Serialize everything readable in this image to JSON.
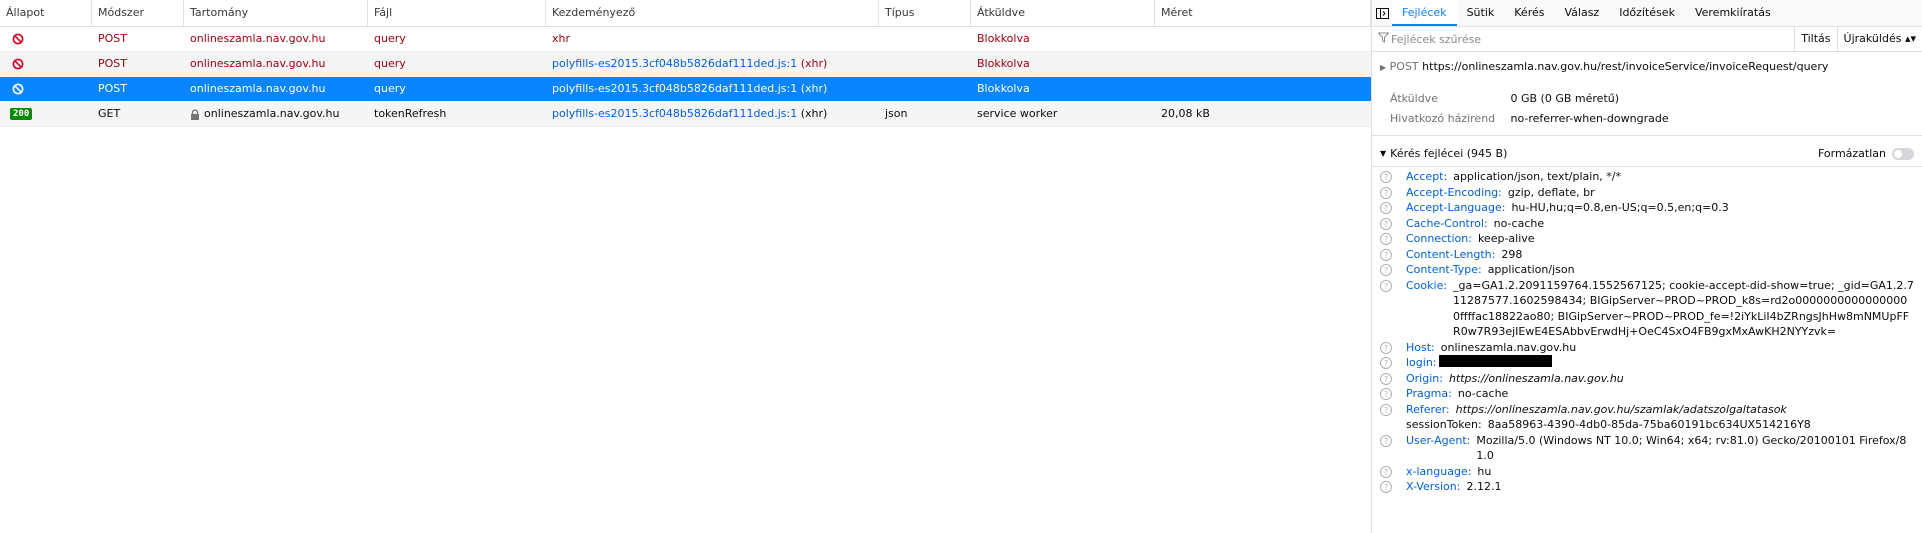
{
  "columns": [
    "Állapot",
    "Módszer",
    "Tartomány",
    "Fájl",
    "Kezdeményező",
    "Típus",
    "Átküldve",
    "Méret"
  ],
  "requests": [
    {
      "status": "blocked",
      "method": "POST",
      "domain": "onlineszamla.nav.gov.hu",
      "file": "query",
      "initiator": "xhr",
      "initiator_suffix": "",
      "type": "",
      "transferred": "Blokkolva",
      "size": ""
    },
    {
      "status": "blocked",
      "method": "POST",
      "domain": "onlineszamla.nav.gov.hu",
      "file": "query",
      "initiator": "polyfills-es2015.3cf048b5826daf111ded.js:1",
      "initiator_suffix": "(xhr)",
      "type": "",
      "transferred": "Blokkolva",
      "size": ""
    },
    {
      "status": "blocked",
      "method": "POST",
      "domain": "onlineszamla.nav.gov.hu",
      "file": "query",
      "initiator": "polyfills-es2015.3cf048b5826daf111ded.js:1",
      "initiator_suffix": "(xhr)",
      "type": "",
      "transferred": "Blokkolva",
      "size": ""
    },
    {
      "status": "200",
      "method": "GET",
      "domain": "onlineszamla.nav.gov.hu",
      "file": "tokenRefresh",
      "initiator": "polyfills-es2015.3cf048b5826daf111ded.js:1",
      "initiator_suffix": "(xhr)",
      "type": "json",
      "transferred": "service worker",
      "size": "20,08 kB"
    }
  ],
  "panel": {
    "tabs": [
      "Fejlécek",
      "Sütik",
      "Kérés",
      "Válasz",
      "Időzítések",
      "Veremkiíratás"
    ],
    "filter_placeholder": "Fejlécek szűrése",
    "block_label": "Tiltás",
    "resend_label": "Újraküldés",
    "summary": {
      "method": "POST",
      "url": "https://onlineszamla.nav.gov.hu/rest/invoiceService/invoiceRequest/query",
      "transferred_label": "Átküldve",
      "transferred_value": "0 GB (0 GB méretű)",
      "referrer_label": "Hivatkozó házirend",
      "referrer_value": "no-referrer-when-downgrade"
    },
    "request_headers_title": "Kérés fejlécei (945 B)",
    "raw_label": "Formázatlan",
    "headers": [
      {
        "name": "Accept:",
        "value": "application/json, text/plain, */*"
      },
      {
        "name": "Accept-Encoding:",
        "value": "gzip, deflate, br"
      },
      {
        "name": "Accept-Language:",
        "value": "hu-HU,hu;q=0.8,en-US;q=0.5,en;q=0.3"
      },
      {
        "name": "Cache-Control:",
        "value": "no-cache"
      },
      {
        "name": "Connection:",
        "value": "keep-alive"
      },
      {
        "name": "Content-Length:",
        "value": "298"
      },
      {
        "name": "Content-Type:",
        "value": "application/json"
      },
      {
        "name": "Cookie:",
        "value": "_ga=GA1.2.2091159764.1552567125; cookie-accept-did-show=true; _gid=GA1.2.711287577.1602598434; BIGipServer~PROD~PROD_k8s=rd2o00000000000000000ffffac18822ao80; BIGipServer~PROD~PROD_fe=!2iYkLiI4bZRngsJhHw8mNMUpFFR0w7R93ejIEwE4ESAbbvErwdHj+OeC4SxO4FB9gxMxAwKH2NYYzvk="
      },
      {
        "name": "Host:",
        "value": "onlineszamla.nav.gov.hu"
      },
      {
        "name": "login:",
        "value": "",
        "redacted": true
      },
      {
        "name": "Origin:",
        "value": "https://onlineszamla.nav.gov.hu",
        "italic": true
      },
      {
        "name": "Pragma:",
        "value": "no-cache"
      },
      {
        "name": "Referer:",
        "value": "https://onlineszamla.nav.gov.hu/szamlak/adatszolgaltatasok",
        "italic": true
      },
      {
        "name": "sessionToken:",
        "value": "8aa58963-4390-4db0-85da-75ba60191bc634UX514216Y8",
        "plain": true
      },
      {
        "name": "User-Agent:",
        "value": "Mozilla/5.0 (Windows NT 10.0; Win64; x64; rv:81.0) Gecko/20100101 Firefox/81.0"
      },
      {
        "name": "x-language:",
        "value": "hu"
      },
      {
        "name": "X-Version:",
        "value": "2.12.1"
      }
    ]
  }
}
